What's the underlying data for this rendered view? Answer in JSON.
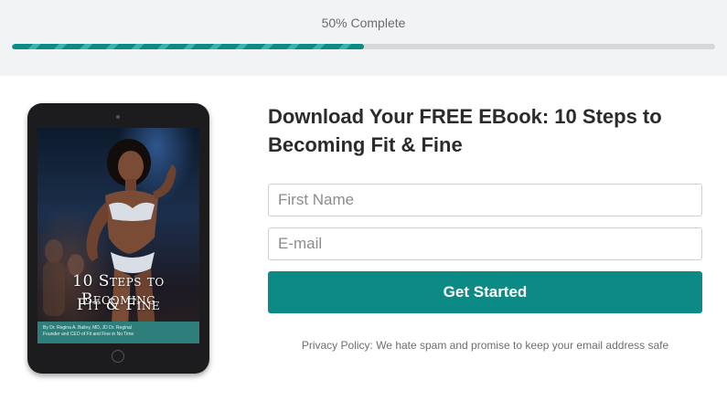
{
  "progress": {
    "label": "50% Complete",
    "percent": 50,
    "fill_color": "#0b8a86"
  },
  "ebook": {
    "title_line1": "10 Steps to Becoming",
    "title_line2": "Fit & Fine",
    "byline_line1": "By Dr. Regina A. Bailey, MD, JD Dr. Reginal",
    "byline_line2": "Founder and CEO of Fit and Fine in No Time"
  },
  "form": {
    "headline": "Download Your FREE EBook: 10 Steps to Becoming Fit & Fine",
    "first_name": {
      "value": "",
      "placeholder": "First Name"
    },
    "email": {
      "value": "",
      "placeholder": "E-mail"
    },
    "submit_label": "Get Started",
    "privacy_text": "Privacy Policy: We hate spam and promise to keep your email address safe"
  },
  "colors": {
    "accent": "#0b8a86",
    "background": "#ffffff",
    "topbar": "#f2f3f5"
  }
}
